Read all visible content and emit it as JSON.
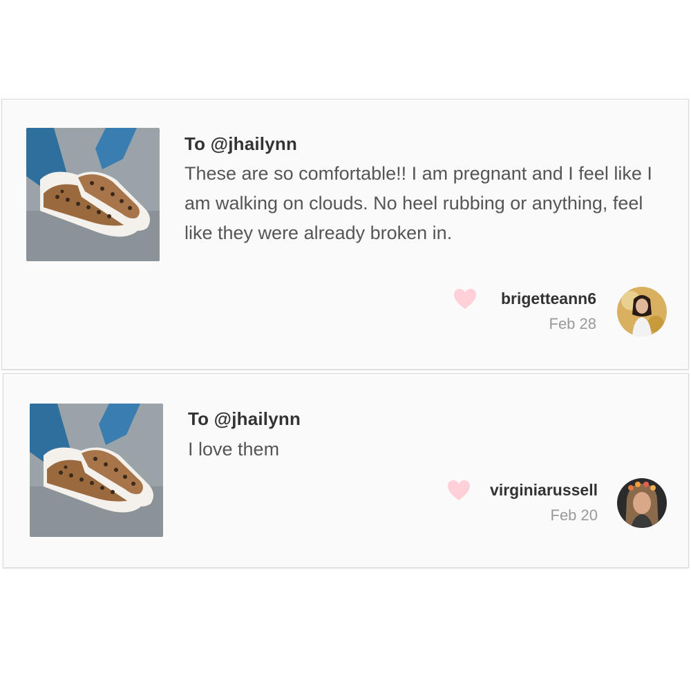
{
  "comments": [
    {
      "to": "To @jhailynn",
      "text": "These are so comfortable!! I am pregnant and I feel like I am walking on clouds. No heel rubbing or anything, feel like they were already broken in.",
      "username": "brigetteann6",
      "date": "Feb 28",
      "thumbnail": "leopard-slip-on-sneakers-photo",
      "avatar": "user-avatar-photo"
    },
    {
      "to": "To @jhailynn",
      "text": "I love them",
      "username": "virginiarussell",
      "date": "Feb 20",
      "thumbnail": "leopard-slip-on-sneakers-photo",
      "avatar": "user-avatar-photo"
    }
  ],
  "colors": {
    "heart": "#ffd0d8",
    "username": "#333333",
    "date": "#999999",
    "text": "#555555"
  },
  "icons": {
    "like": "heart-icon"
  }
}
